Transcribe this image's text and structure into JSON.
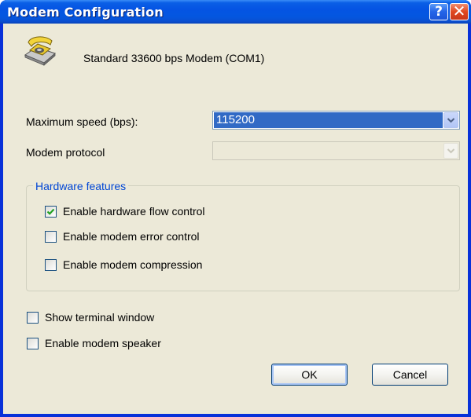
{
  "window": {
    "title": "Modem Configuration",
    "help_label": "?",
    "close_label": "✕"
  },
  "modem": {
    "name": "Standard 33600 bps Modem (COM1)",
    "icon": "telephone-modem-icon"
  },
  "max_speed": {
    "label": "Maximum speed (bps):",
    "value": "115200"
  },
  "protocol": {
    "label": "Modem protocol",
    "value": ""
  },
  "hardware": {
    "legend": "Hardware features",
    "flow_control": {
      "label": "Enable hardware flow control",
      "checked": true
    },
    "error_control": {
      "label": "Enable modem error control",
      "checked": false
    },
    "compression": {
      "label": "Enable modem compression",
      "checked": false
    }
  },
  "options": {
    "terminal": {
      "label": "Show terminal window",
      "checked": false
    },
    "speaker": {
      "label": "Enable modem speaker",
      "checked": false
    }
  },
  "buttons": {
    "ok": "OK",
    "cancel": "Cancel"
  },
  "colors": {
    "title_bar": "#0554e3",
    "client": "#ece9d8",
    "selection": "#316ac5",
    "group_legend": "#0046d5"
  }
}
